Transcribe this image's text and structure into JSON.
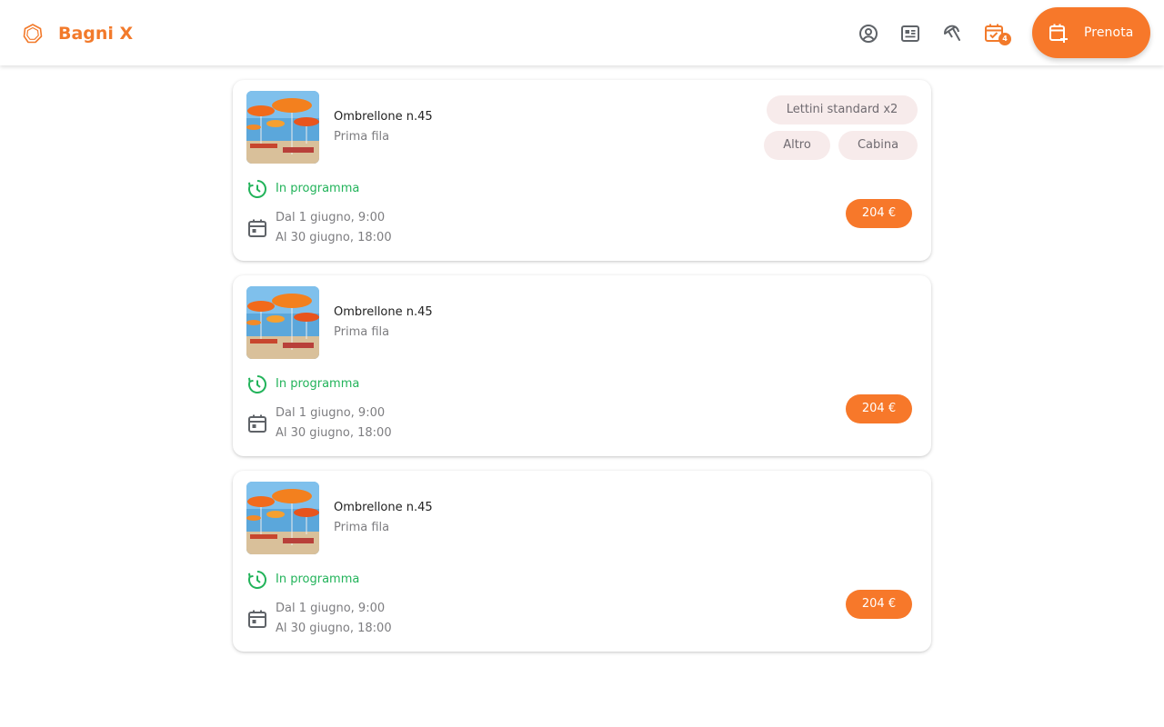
{
  "header": {
    "brand": "Bagni X",
    "notification_count": "4",
    "cta_label": "Prenota",
    "icons": [
      "hexagon-logo-icon",
      "account-circle-icon",
      "newspaper-icon",
      "beach-umbrella-icon",
      "calendar-check-icon",
      "calendar-plus-icon"
    ]
  },
  "colors": {
    "accent": "#f7782a",
    "status_green": "#22b35a",
    "chip_bg": "#f7ebeb",
    "muted_text": "#7d7d80"
  },
  "bookings": [
    {
      "title": "Ombrellone n.45",
      "subtitle": "Prima fila",
      "chips": [
        "Lettini standard x2",
        "Altro",
        "Cabina"
      ],
      "status": "In programma",
      "date_from": "Dal 1 giugno, 9:00",
      "date_to": "Al 30 giugno, 18:00",
      "price": "204 €"
    },
    {
      "title": "Ombrellone n.45",
      "subtitle": "Prima fila",
      "chips": [],
      "status": "In programma",
      "date_from": "Dal 1 giugno, 9:00",
      "date_to": "Al 30 giugno, 18:00",
      "price": "204 €"
    },
    {
      "title": "Ombrellone n.45",
      "subtitle": "Prima fila",
      "chips": [],
      "status": "In programma",
      "date_from": "Dal 1 giugno, 9:00",
      "date_to": "Al 30 giugno, 18:00",
      "price": "204 €"
    }
  ]
}
